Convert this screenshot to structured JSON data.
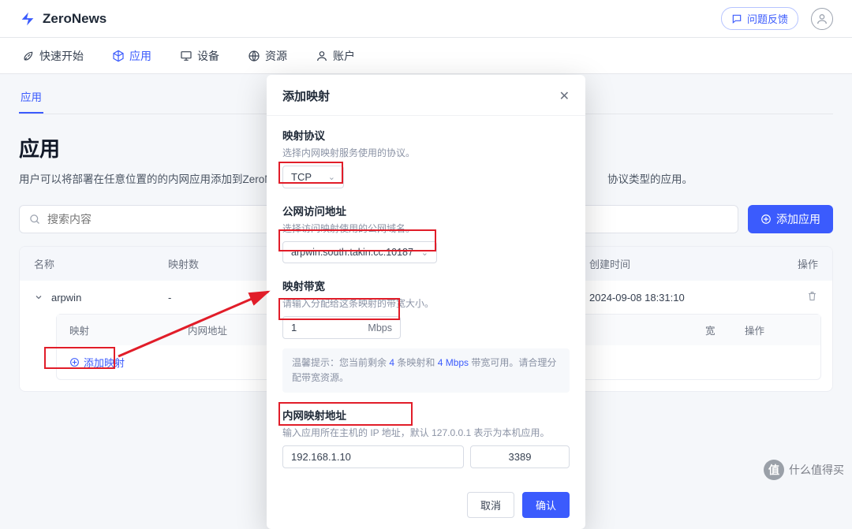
{
  "brand": {
    "name": "ZeroNews"
  },
  "top": {
    "feedback": "问题反馈"
  },
  "nav": {
    "items": [
      {
        "label": "快速开始"
      },
      {
        "label": "应用",
        "active": true
      },
      {
        "label": "设备"
      },
      {
        "label": "资源"
      },
      {
        "label": "账户"
      }
    ]
  },
  "subtab": {
    "label": "应用"
  },
  "page": {
    "title": "应用",
    "desc_before": "用户可以将部署在任意位置的的内网应用添加到ZeroNews平",
    "desc_after": "协议类型的应用。"
  },
  "search": {
    "placeholder": "搜索内容"
  },
  "actions": {
    "add_app": "添加应用"
  },
  "table": {
    "cols": {
      "name": "名称",
      "maps": "映射数",
      "created": "创建时间",
      "ops": "操作"
    },
    "row": {
      "name": "arpwin",
      "maps": "-",
      "created": "2024-09-08 18:31:10"
    }
  },
  "subpanel": {
    "cols": {
      "map": "映射",
      "inner": "内网地址",
      "bw": "宽",
      "ops": "操作"
    },
    "add_map": "添加映射"
  },
  "modal": {
    "title": "添加映射",
    "f1": {
      "label": "映射协议",
      "help": "选择内网映射服务使用的协议。",
      "value": "TCP"
    },
    "f2": {
      "label": "公网访问地址",
      "help": "选择访问映射使用的公网域名。",
      "value": "arpwin.south.takin.cc:10187"
    },
    "f3": {
      "label": "映射带宽",
      "help": "请输入分配给这条映射的带宽大小。",
      "value": "1",
      "unit": "Mbps"
    },
    "tip": {
      "pre": "温馨提示：您当前剩余 ",
      "n1": "4",
      "mid1": " 条映射和 ",
      "n2": "4 Mbps",
      "mid2": " 带宽可用。请合理分配带宽资源。"
    },
    "f4": {
      "label": "内网映射地址",
      "help": "输入应用所在主机的 IP 地址，默认 127.0.0.1 表示为本机应用。",
      "ip": "192.168.1.10",
      "port": "3389"
    },
    "cancel": "取消",
    "ok": "确认"
  },
  "watermark": {
    "text": "什么值得买"
  }
}
